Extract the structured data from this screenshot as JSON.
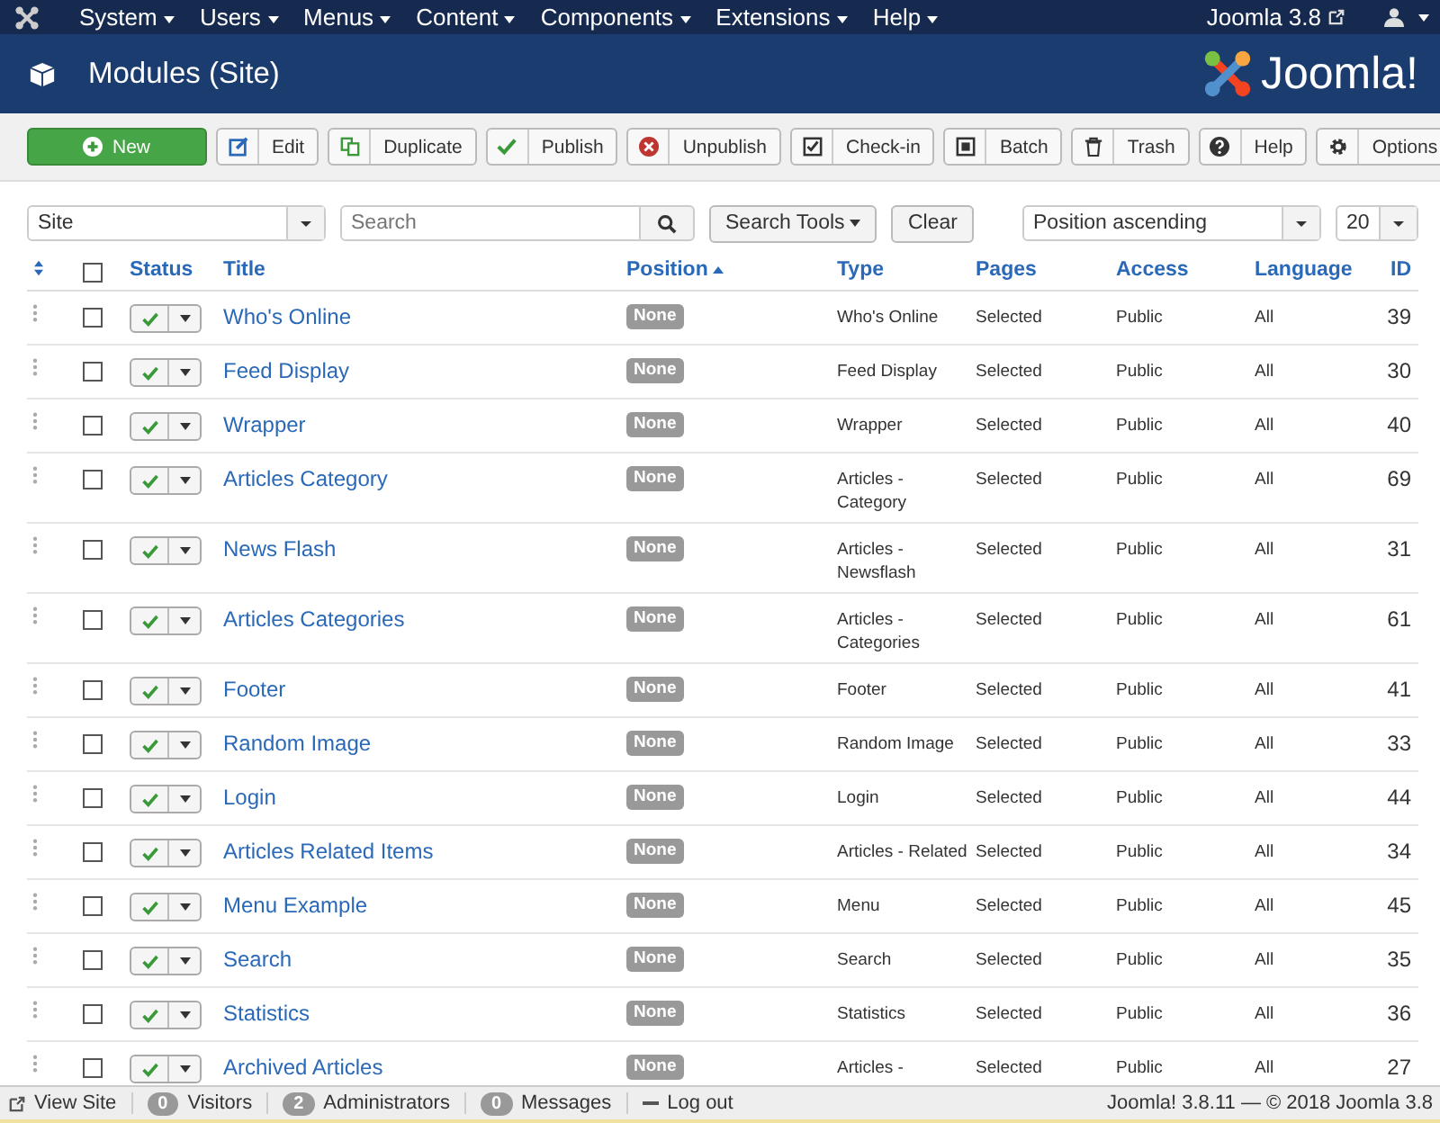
{
  "navbar": {
    "menus": [
      "System",
      "Users",
      "Menus",
      "Content",
      "Components",
      "Extensions",
      "Help"
    ],
    "site_link": "Joomla 3.8"
  },
  "header": {
    "title": "Modules (Site)",
    "logo": "Joomla!"
  },
  "toolbar": [
    {
      "kind": "new",
      "label": "New"
    },
    {
      "kind": "edit",
      "label": "Edit"
    },
    {
      "kind": "duplicate",
      "label": "Duplicate"
    },
    {
      "kind": "publish",
      "label": "Publish"
    },
    {
      "kind": "unpublish",
      "label": "Unpublish"
    },
    {
      "kind": "checkin",
      "label": "Check-in"
    },
    {
      "kind": "batch",
      "label": "Batch"
    },
    {
      "kind": "trash",
      "label": "Trash"
    },
    {
      "kind": "help",
      "label": "Help"
    },
    {
      "kind": "options",
      "label": "Options"
    }
  ],
  "filters": {
    "client": "Site",
    "search": {
      "placeholder": "Search"
    },
    "search_tools": "Search Tools",
    "clear": "Clear",
    "ordering": "Position ascending",
    "limit": "20"
  },
  "table": {
    "select_all_checked": false,
    "columns": [
      {
        "label": "Status",
        "sorted": false
      },
      {
        "label": "Title",
        "sorted": false
      },
      {
        "label": "Position",
        "sorted": true
      },
      {
        "label": "Type",
        "sorted": false
      },
      {
        "label": "Pages",
        "sorted": false
      },
      {
        "label": "Access",
        "sorted": false
      },
      {
        "label": "Language",
        "sorted": false
      },
      {
        "label": "ID",
        "sorted": false
      }
    ],
    "rows": [
      {
        "title": "Who's Online",
        "position": "None",
        "type": "Who's Online",
        "pages": "Selected",
        "access": "Public",
        "language": "All",
        "id": "39",
        "published": true,
        "checked": false
      },
      {
        "title": "Feed Display",
        "position": "None",
        "type": "Feed Display",
        "pages": "Selected",
        "access": "Public",
        "language": "All",
        "id": "30",
        "published": true,
        "checked": false
      },
      {
        "title": "Wrapper",
        "position": "None",
        "type": "Wrapper",
        "pages": "Selected",
        "access": "Public",
        "language": "All",
        "id": "40",
        "published": true,
        "checked": false
      },
      {
        "title": "Articles Category",
        "position": "None",
        "type": "Articles -\nCategory",
        "pages": "Selected",
        "access": "Public",
        "language": "All",
        "id": "69",
        "published": true,
        "checked": false
      },
      {
        "title": "News Flash",
        "position": "None",
        "type": "Articles -\nNewsflash",
        "pages": "Selected",
        "access": "Public",
        "language": "All",
        "id": "31",
        "published": true,
        "checked": false
      },
      {
        "title": "Articles Categories",
        "position": "None",
        "type": "Articles -\nCategories",
        "pages": "Selected",
        "access": "Public",
        "language": "All",
        "id": "61",
        "published": true,
        "checked": false
      },
      {
        "title": "Footer",
        "position": "None",
        "type": "Footer",
        "pages": "Selected",
        "access": "Public",
        "language": "All",
        "id": "41",
        "published": true,
        "checked": false
      },
      {
        "title": "Random Image",
        "position": "None",
        "type": "Random Image",
        "pages": "Selected",
        "access": "Public",
        "language": "All",
        "id": "33",
        "published": true,
        "checked": false
      },
      {
        "title": "Login",
        "position": "None",
        "type": "Login",
        "pages": "Selected",
        "access": "Public",
        "language": "All",
        "id": "44",
        "published": true,
        "checked": false
      },
      {
        "title": "Articles Related Items",
        "position": "None",
        "type": "Articles - Related",
        "pages": "Selected",
        "access": "Public",
        "language": "All",
        "id": "34",
        "published": true,
        "checked": false
      },
      {
        "title": "Menu Example",
        "position": "None",
        "type": "Menu",
        "pages": "Selected",
        "access": "Public",
        "language": "All",
        "id": "45",
        "published": true,
        "checked": false
      },
      {
        "title": "Search",
        "position": "None",
        "type": "Search",
        "pages": "Selected",
        "access": "Public",
        "language": "All",
        "id": "35",
        "published": true,
        "checked": false
      },
      {
        "title": "Statistics",
        "position": "None",
        "type": "Statistics",
        "pages": "Selected",
        "access": "Public",
        "language": "All",
        "id": "36",
        "published": true,
        "checked": false
      },
      {
        "title": "Archived Articles",
        "position": "None",
        "type": "Articles -",
        "pages": "Selected",
        "access": "Public",
        "language": "All",
        "id": "27",
        "published": true,
        "checked": false
      }
    ]
  },
  "status_bar": {
    "view_site": "View Site",
    "counters": [
      {
        "count": "0",
        "label": "Visitors"
      },
      {
        "count": "2",
        "label": "Administrators"
      },
      {
        "count": "0",
        "label": "Messages"
      }
    ],
    "logout": "Log out",
    "version": "Joomla! 3.8.11 — © 2018 Joomla 3.8"
  }
}
